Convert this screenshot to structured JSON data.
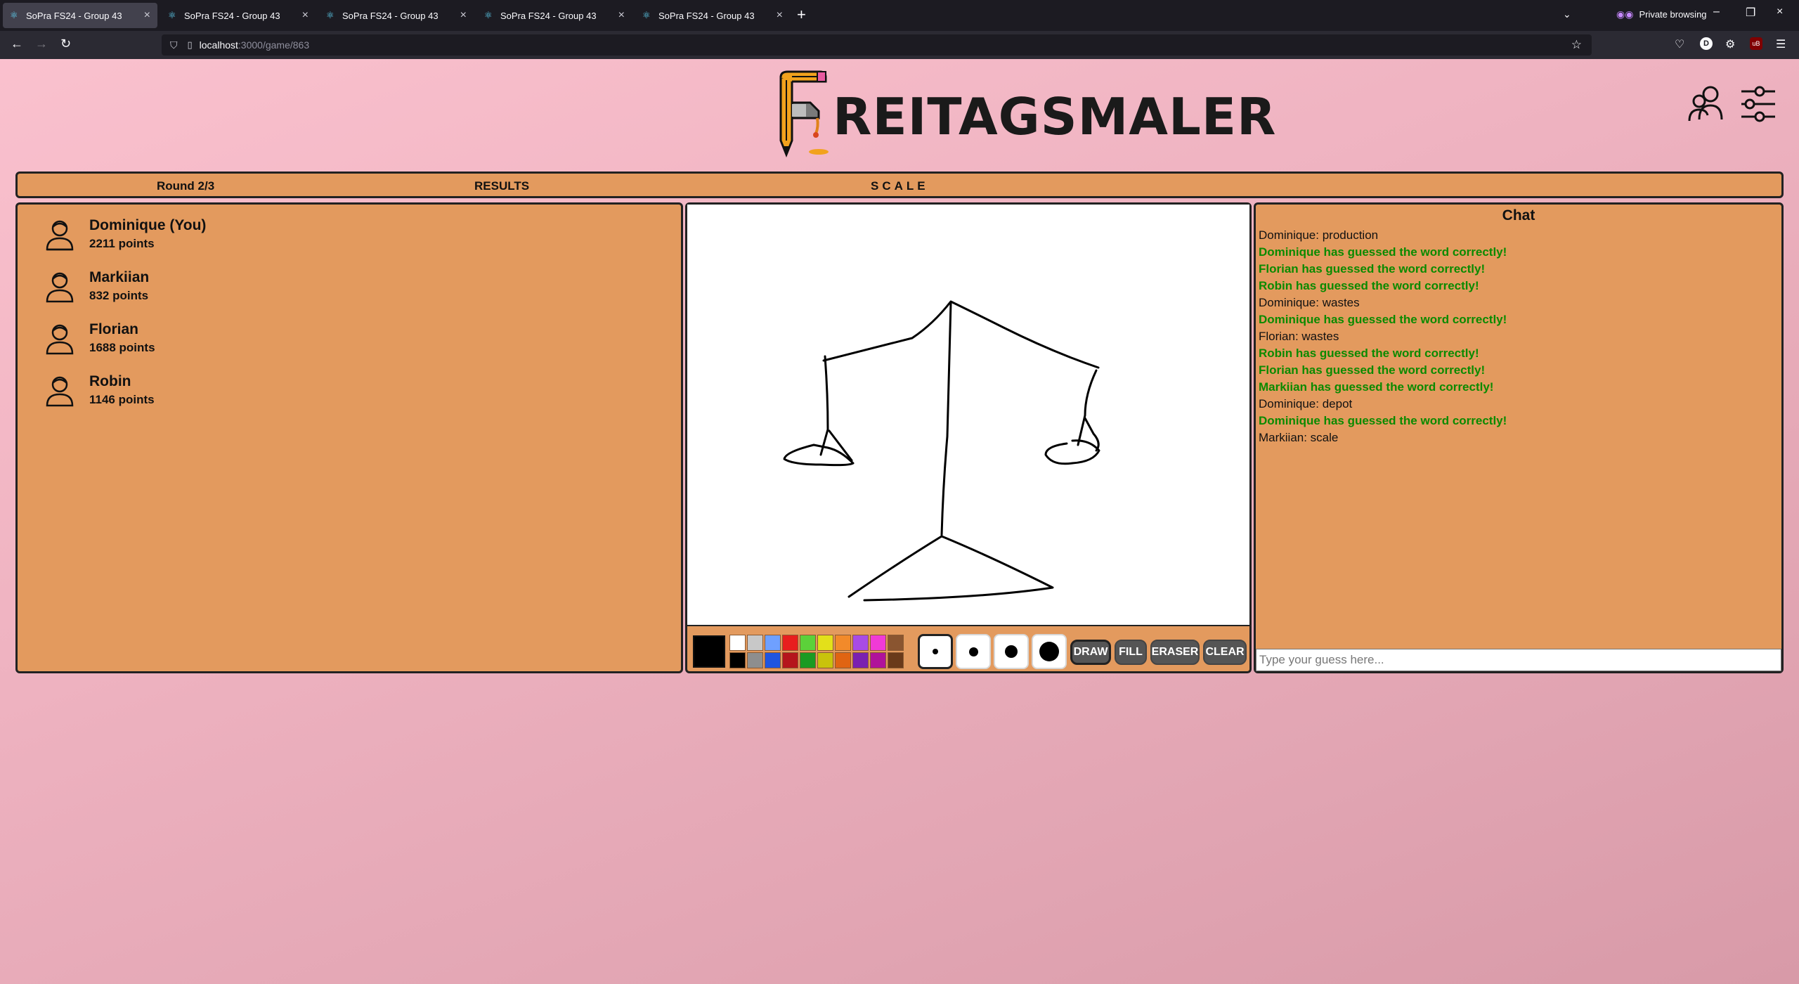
{
  "browser": {
    "tabs": [
      {
        "title": "SoPra FS24 - Group 43",
        "active": true
      },
      {
        "title": "SoPra FS24 - Group 43",
        "active": false
      },
      {
        "title": "SoPra FS24 - Group 43",
        "active": false
      },
      {
        "title": "SoPra FS24 - Group 43",
        "active": false
      },
      {
        "title": "SoPra FS24 - Group 43",
        "active": false
      }
    ],
    "private_label": "Private browsing",
    "url_host": "localhost",
    "url_path": ":3000/game/863",
    "profile_initial": "D",
    "ublock_label": "uB"
  },
  "app": {
    "logo_text": "REITAGSMALER"
  },
  "infobar": {
    "round": "Round 2/3",
    "results": "RESULTS",
    "word": "SCALE"
  },
  "players": [
    {
      "name": "Dominique (You)",
      "points": "2211 points"
    },
    {
      "name": "Markiian",
      "points": "832 points"
    },
    {
      "name": "Florian",
      "points": "1688 points"
    },
    {
      "name": "Robin",
      "points": "1146 points"
    }
  ],
  "palette": {
    "current": "#000000",
    "top_row": [
      "#ffffff",
      "#c8c8c8",
      "#6fa0ff",
      "#e81e1e",
      "#5cd13a",
      "#e3e01a",
      "#f28a2a",
      "#a84be6",
      "#f03ad6",
      "#8a5530"
    ],
    "bottom_row": [
      "#000000",
      "#8e8e8e",
      "#1f55e0",
      "#b5151c",
      "#1b9a22",
      "#c9c30c",
      "#e06412",
      "#7a20b0",
      "#b0129a",
      "#6a3a1a"
    ]
  },
  "tools": {
    "draw": "DRAW",
    "fill": "FILL",
    "eraser": "ERASER",
    "clear": "CLEAR"
  },
  "chat": {
    "title": "Chat",
    "messages": [
      {
        "text": "Dominique: production",
        "type": "normal"
      },
      {
        "text": "Dominique has guessed the word correctly!",
        "type": "guess"
      },
      {
        "text": "Florian has guessed the word correctly!",
        "type": "guess"
      },
      {
        "text": "Robin has guessed the word correctly!",
        "type": "guess"
      },
      {
        "text": "Dominique: wastes",
        "type": "normal"
      },
      {
        "text": "Dominique has guessed the word correctly!",
        "type": "guess"
      },
      {
        "text": "Florian: wastes",
        "type": "normal"
      },
      {
        "text": "Robin has guessed the word correctly!",
        "type": "guess"
      },
      {
        "text": "Florian has guessed the word correctly!",
        "type": "guess"
      },
      {
        "text": "Markiian has guessed the word correctly!",
        "type": "guess"
      },
      {
        "text": "Dominique: depot",
        "type": "normal"
      },
      {
        "text": "Dominique has guessed the word correctly!",
        "type": "guess"
      },
      {
        "text": "Markiian: scale",
        "type": "normal"
      }
    ],
    "input_placeholder": "Type your guess here..."
  }
}
